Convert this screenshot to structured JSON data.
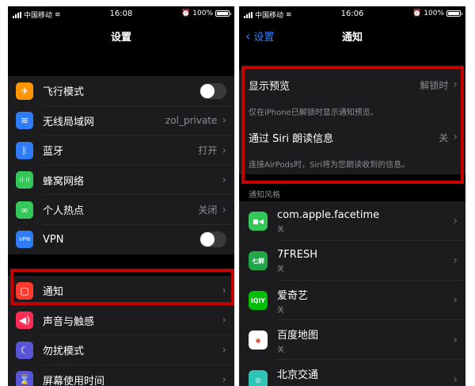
{
  "left": {
    "status": {
      "carrier": "中国移动",
      "time": "16:08",
      "battery": "100%"
    },
    "title": "设置",
    "group1": [
      {
        "label": "飞行模式",
        "icon": "airplane-icon",
        "color": "#ff9500",
        "glyph": "✈",
        "value": "",
        "control": "toggle"
      },
      {
        "label": "无线局域网",
        "icon": "wifi-icon",
        "color": "#2f7cf6",
        "glyph": "≋",
        "value": "zol_private",
        "control": "chevron"
      },
      {
        "label": "蓝牙",
        "icon": "bluetooth-icon",
        "color": "#2f7cf6",
        "glyph": "ᛒ",
        "value": "打开",
        "control": "chevron"
      },
      {
        "label": "蜂窝网络",
        "icon": "cellular-icon",
        "color": "#34c759",
        "glyph": "((·))",
        "value": "",
        "control": "chevron"
      },
      {
        "label": "个人热点",
        "icon": "hotspot-icon",
        "color": "#34c759",
        "glyph": "∞",
        "value": "关闭",
        "control": "chevron"
      },
      {
        "label": "VPN",
        "icon": "vpn-icon",
        "color": "#2f7cf6",
        "glyph": "VPN",
        "value": "",
        "control": "toggle"
      }
    ],
    "group2": [
      {
        "label": "通知",
        "icon": "notifications-icon",
        "color": "#ff3b30",
        "glyph": "▢",
        "value": "",
        "control": "chevron"
      },
      {
        "label": "声音与触感",
        "icon": "sound-icon",
        "color": "#ff2d55",
        "glyph": "◀)",
        "value": "",
        "control": "chevron"
      },
      {
        "label": "勿扰模式",
        "icon": "moon-icon",
        "color": "#5856d6",
        "glyph": "☾",
        "value": "",
        "control": "chevron"
      },
      {
        "label": "屏幕使用时间",
        "icon": "hourglass-icon",
        "color": "#5856d6",
        "glyph": "⌛",
        "value": "",
        "control": "chevron"
      }
    ]
  },
  "right": {
    "status": {
      "carrier": "中国移动",
      "time": "16:06",
      "battery": "100%"
    },
    "back_label": "设置",
    "title": "通知",
    "preview": {
      "label": "显示预览",
      "value": "解锁时",
      "note": "仅在iPhone已解锁时显示通知预览。"
    },
    "siri": {
      "label": "通过 Siri 朗读信息",
      "value": "关",
      "note": "连接AirPods时，Siri将为您朗读收到的信息。"
    },
    "section_label": "通知风格",
    "apps": [
      {
        "name": "com.apple.facetime",
        "status": "关",
        "icon": "facetime-icon",
        "color": "#34c759",
        "glyph": "■◀"
      },
      {
        "name": "7FRESH",
        "status": "关",
        "icon": "7fresh-icon",
        "color": "#1fa74a",
        "glyph": "七鲜"
      },
      {
        "name": "爱奇艺",
        "status": "关",
        "icon": "iqiyi-icon",
        "color": "#00be06",
        "glyph": "iQIY"
      },
      {
        "name": "百度地图",
        "status": "关",
        "icon": "baidu-map-icon",
        "color": "#ffffff",
        "glyph": "◉"
      },
      {
        "name": "北京交通",
        "status": "关",
        "icon": "beijing-transit-icon",
        "color": "#2ec4b6",
        "glyph": "◎"
      }
    ]
  },
  "highlight_color": "#c40000"
}
